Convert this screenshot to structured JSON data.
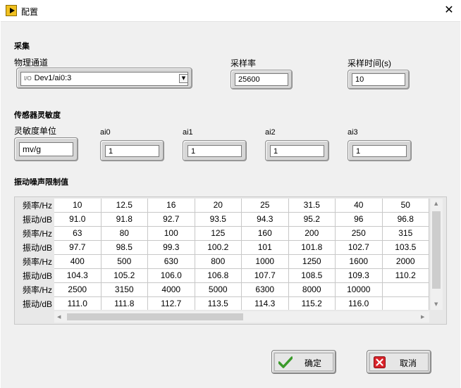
{
  "window": {
    "title": "配置",
    "close_glyph": "✕"
  },
  "acquisition": {
    "section_title": "采集",
    "channel_label": "物理通道",
    "channel_io_glyph": "I/O",
    "channel_value": "Dev1/ai0:3",
    "rate_label": "采样率",
    "rate_value": "25600",
    "time_label": "采样时间(s)",
    "time_value": "10"
  },
  "sensitivity": {
    "section_title": "传感器灵敏度",
    "unit_label": "灵敏度单位",
    "unit_value": "mv/g",
    "channels": [
      {
        "label": "ai0",
        "value": "1"
      },
      {
        "label": "ai1",
        "value": "1"
      },
      {
        "label": "ai2",
        "value": "1"
      },
      {
        "label": "ai3",
        "value": "1"
      }
    ]
  },
  "noise": {
    "section_title": "振动噪声限制值",
    "row_labels": [
      "频率/Hz",
      "振动/dB",
      "频率/Hz",
      "振动/dB",
      "频率/Hz",
      "振动/dB",
      "频率/Hz",
      "振动/dB"
    ],
    "rows": [
      [
        "10",
        "12.5",
        "16",
        "20",
        "25",
        "31.5",
        "40",
        "50"
      ],
      [
        "91.0",
        "91.8",
        "92.7",
        "93.5",
        "94.3",
        "95.2",
        "96",
        "96.8"
      ],
      [
        "63",
        "80",
        "100",
        "125",
        "160",
        "200",
        "250",
        "315"
      ],
      [
        "97.7",
        "98.5",
        "99.3",
        "100.2",
        "101",
        "101.8",
        "102.7",
        "103.5"
      ],
      [
        "400",
        "500",
        "630",
        "800",
        "1000",
        "1250",
        "1600",
        "2000"
      ],
      [
        "104.3",
        "105.2",
        "106.0",
        "106.8",
        "107.7",
        "108.5",
        "109.3",
        "110.2"
      ],
      [
        "2500",
        "3150",
        "4000",
        "5000",
        "6300",
        "8000",
        "10000",
        ""
      ],
      [
        "111.0",
        "111.8",
        "112.7",
        "113.5",
        "114.3",
        "115.2",
        "116.0",
        ""
      ]
    ]
  },
  "buttons": {
    "ok_label": "确定",
    "cancel_label": "取消"
  }
}
